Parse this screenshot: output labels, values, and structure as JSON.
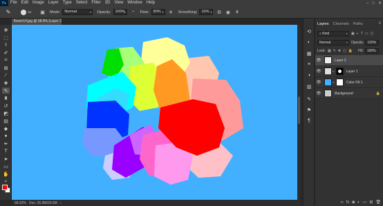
{
  "menu": {
    "logo": "Ps",
    "items": [
      "File",
      "Edit",
      "Image",
      "Layer",
      "Type",
      "Select",
      "Filter",
      "3D",
      "View",
      "Window",
      "Help"
    ],
    "win_controls": [
      "–",
      "□",
      "✕"
    ]
  },
  "options": {
    "brush_size": "15",
    "mode_label": "Mode:",
    "mode_value": "Normal",
    "opacity_label": "Opacity:",
    "opacity_value": "100%",
    "flow_label": "Flow:",
    "flow_value": "80%",
    "smoothing_label": "Smoothing:",
    "smoothing_value": "10%"
  },
  "document": {
    "tab_title": "flower14.jpg @ 68.9% (Layer 2, RGB/8) *",
    "canvas_bg": "#42b0ff",
    "status_zoom": "68.92%",
    "status_doc": "Doc: 26.8M/29.9M"
  },
  "colors": {
    "foreground": "#ff0000",
    "background": "#ffffff"
  },
  "layers_panel": {
    "tabs": [
      "Layers",
      "Channels",
      "Paths"
    ],
    "kind_label": "Kind",
    "blend_mode": "Normal",
    "opacity_label": "Opacity:",
    "opacity_value": "100%",
    "lock_label": "Lock:",
    "fill_label": "Fill:",
    "fill_value": "100%",
    "layers": [
      {
        "name": "Layer 2",
        "selected": true
      },
      {
        "name": "Layer 1",
        "selected": false
      },
      {
        "name": "Color Fill 1",
        "selected": false
      },
      {
        "name": "Background",
        "selected": false
      }
    ],
    "footer_icons": [
      "link-icon",
      "fx-icon",
      "mask-icon",
      "adjustment-icon",
      "group-icon",
      "new-layer-icon",
      "trash-icon"
    ]
  }
}
